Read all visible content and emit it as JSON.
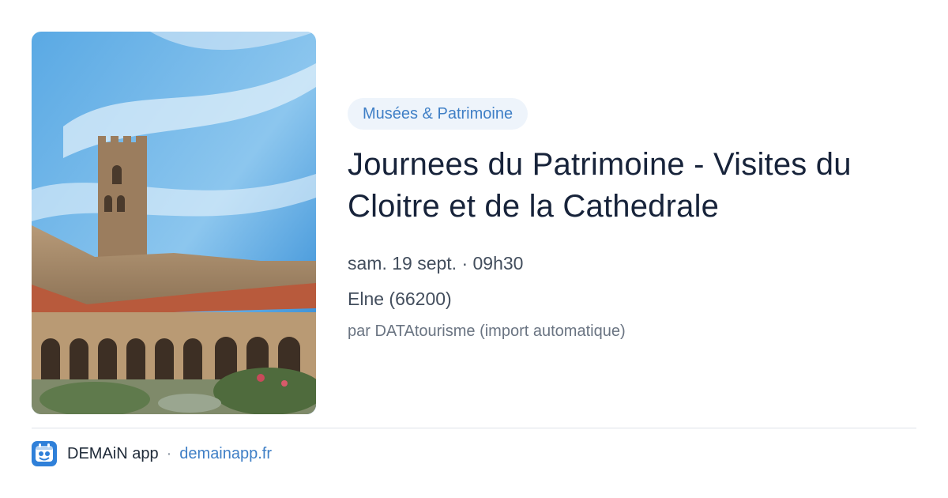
{
  "event": {
    "category": "Musées & Patrimoine",
    "title": "Journees du Patrimoine - Visites du Cloitre et de la Cathedrale",
    "date_time": "sam. 19 sept. · 09h30",
    "location": "Elne (66200)",
    "source": "par DATAtourisme (import automatique)"
  },
  "footer": {
    "app_name": "DEMAiN app",
    "separator": "·",
    "link_text": "demainapp.fr"
  },
  "colors": {
    "accent": "#3f7fc6",
    "pill_background": "#eef4fb",
    "title": "#17233a",
    "divider": "#dde3e9"
  },
  "icons": {
    "app_logo": "demain-app-icon",
    "image": "cloister-cathedral-photo"
  }
}
